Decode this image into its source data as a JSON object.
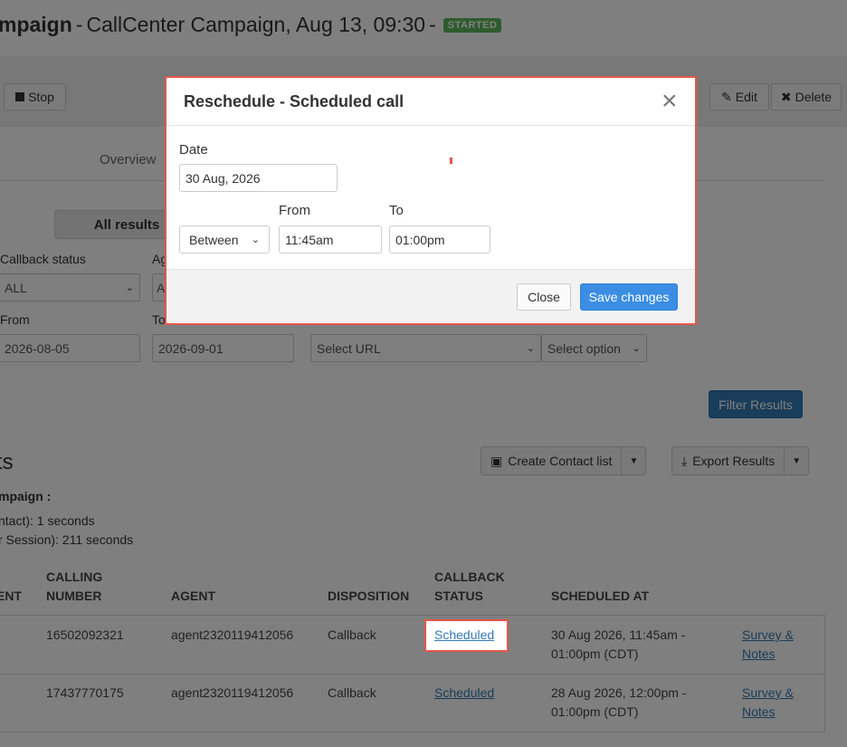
{
  "header": {
    "title_part1": "mpaign",
    "title_part2": "CallCenter Campaign, Aug 13, 09:30",
    "status_badge": "STARTED"
  },
  "toolbar": {
    "stop_label": "Stop",
    "edit_label": "Edit",
    "delete_label": "Delete",
    "edit_icon": "edit-icon",
    "delete_icon": "x-icon"
  },
  "tabs": {
    "overview": "Overview"
  },
  "segment": {
    "all_results": "All results"
  },
  "filters": {
    "callback_status_label": "Callback status",
    "callback_status_value": "ALL",
    "agent_label": "Ag",
    "agent_value": "A",
    "from_label": "From",
    "from_value": "2026-08-05",
    "to_label": "To",
    "to_value": "2026-09-01",
    "url_value": "Select URL",
    "option_value": "Select option",
    "filter_button": "Filter Results"
  },
  "results": {
    "title": "ts",
    "campaign_label": "mpaign :",
    "line1": "ntact): 1 seconds",
    "line2": "r Session): 211 seconds",
    "create_contact_list": "Create Contact list",
    "export_results": "Export Results"
  },
  "table": {
    "headers": {
      "c0": "ENT",
      "c1a": "CALLING",
      "c1b": "NUMBER",
      "c2": "AGENT",
      "c3": "DISPOSITION",
      "c4a": "CALLBACK",
      "c4b": "STATUS",
      "c5": "SCHEDULED AT"
    },
    "rows": [
      {
        "calling_number": "16502092321",
        "agent": "agent2320119412056",
        "disposition": "Callback",
        "status": "Scheduled",
        "scheduled_at_1": "30 Aug 2026, 11:45am -",
        "scheduled_at_2": "01:00pm (CDT)",
        "notes_1": "Survey &",
        "notes_2": "Notes"
      },
      {
        "calling_number": "17437770175",
        "agent": "agent2320119412056",
        "disposition": "Callback",
        "status": "Scheduled",
        "scheduled_at_1": "28 Aug 2026, 12:00pm -",
        "scheduled_at_2": "01:00pm (CDT)",
        "notes_1": "Survey &",
        "notes_2": "Notes"
      }
    ]
  },
  "modal": {
    "title": "Reschedule - Scheduled call",
    "close_x": "×",
    "date_label": "Date",
    "date_value": "30 Aug, 2026",
    "range_mode": "Between",
    "from_label": "From",
    "from_value": "11:45am",
    "to_label": "To",
    "to_value": "01:00pm",
    "close_button": "Close",
    "save_button": "Save changes"
  },
  "colors": {
    "accent_blue": "#3b8ee3",
    "highlight_red": "#e4574b",
    "badge_green": "#5cb85c"
  }
}
